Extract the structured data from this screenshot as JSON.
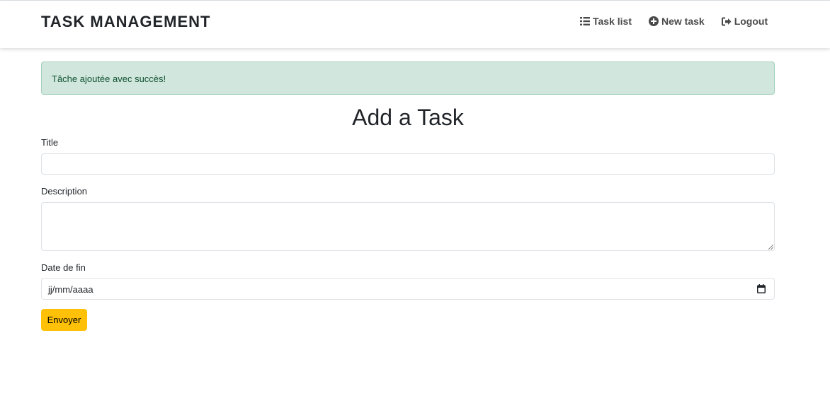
{
  "brand": "TASK MANAGEMENT",
  "nav": {
    "task_list": "Task list",
    "new_task": "New task",
    "logout": "Logout"
  },
  "alert": {
    "message": "Tâche ajoutée avec succès!"
  },
  "form": {
    "heading": "Add a Task",
    "title_label": "Title",
    "title_value": "",
    "description_label": "Description",
    "description_value": "",
    "date_label": "Date de fin",
    "date_placeholder": "jj/mm/aaaa",
    "submit_label": "Envoyer"
  },
  "colors": {
    "alert_bg": "#d1e7dd",
    "button_bg": "#ffc107"
  },
  "icons": {
    "task_list": "list-icon",
    "new_task": "plus-circle-icon",
    "logout": "logout-icon",
    "date": "calendar-icon"
  }
}
